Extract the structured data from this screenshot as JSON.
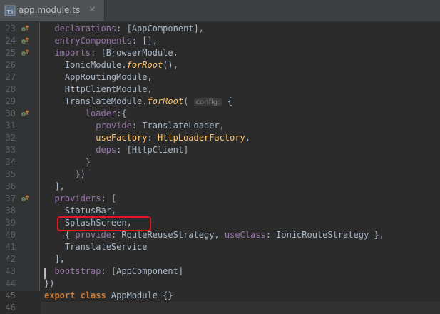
{
  "tab": {
    "icon_label": "TS",
    "title": "app.module.ts",
    "close_glyph": "×"
  },
  "colors": {
    "keyword": "#cc7832",
    "property": "#9876aa",
    "function": "#ffc66d",
    "default_text": "#a9b7c6",
    "highlight_box": "#e0191d"
  },
  "editor": {
    "line_numbers": [
      "23",
      "24",
      "25",
      "26",
      "27",
      "28",
      "29",
      "30",
      "31",
      "32",
      "33",
      "34",
      "35",
      "36",
      "37",
      "38",
      "39",
      "40",
      "41",
      "42",
      "43",
      "44",
      "45",
      "46"
    ],
    "lines": [
      {
        "indent": "  ",
        "t": [
          [
            "p",
            "declarations"
          ],
          [
            "d",
            ": [AppComponent],"
          ]
        ]
      },
      {
        "indent": "  ",
        "t": [
          [
            "p",
            "entryComponents"
          ],
          [
            "d",
            ": [],"
          ]
        ]
      },
      {
        "indent": "  ",
        "t": [
          [
            "p",
            "imports"
          ],
          [
            "d",
            ": [BrowserModule,"
          ]
        ]
      },
      {
        "indent": "    ",
        "t": [
          [
            "d",
            "IonicModule."
          ],
          [
            "f",
            "forRoot"
          ],
          [
            "d",
            "(),"
          ]
        ]
      },
      {
        "indent": "    ",
        "t": [
          [
            "d",
            "AppRoutingModule,"
          ]
        ]
      },
      {
        "indent": "    ",
        "t": [
          [
            "d",
            "HttpClientModule,"
          ]
        ]
      },
      {
        "indent": "    ",
        "t": [
          [
            "d",
            "TranslateModule."
          ],
          [
            "f",
            "forRoot"
          ],
          [
            "d",
            "( "
          ],
          [
            "h",
            "config:"
          ],
          [
            "d",
            " {"
          ]
        ]
      },
      {
        "indent": "        ",
        "t": [
          [
            "p",
            "loader"
          ],
          [
            "d",
            ":{"
          ]
        ]
      },
      {
        "indent": "          ",
        "t": [
          [
            "p",
            "provide"
          ],
          [
            "d",
            ": TranslateLoader,"
          ]
        ]
      },
      {
        "indent": "          ",
        "t": [
          [
            "y",
            "useFactory"
          ],
          [
            "d",
            ": "
          ],
          [
            "y",
            "HttpLoaderFactory"
          ],
          [
            "d",
            ","
          ]
        ]
      },
      {
        "indent": "          ",
        "t": [
          [
            "p",
            "deps"
          ],
          [
            "d",
            ": [HttpClient]"
          ]
        ]
      },
      {
        "indent": "        ",
        "t": [
          [
            "d",
            "}"
          ]
        ]
      },
      {
        "indent": "      ",
        "t": [
          [
            "d",
            "})"
          ]
        ]
      },
      {
        "indent": "  ",
        "t": [
          [
            "d",
            "],"
          ]
        ]
      },
      {
        "indent": "  ",
        "t": [
          [
            "p",
            "providers"
          ],
          [
            "d",
            ": ["
          ]
        ]
      },
      {
        "indent": "    ",
        "t": [
          [
            "d",
            "StatusBar,"
          ]
        ]
      },
      {
        "indent": "    ",
        "t": [
          [
            "d",
            "SplashScreen,"
          ]
        ]
      },
      {
        "indent": "    ",
        "t": [
          [
            "d",
            "{ "
          ],
          [
            "p",
            "provide"
          ],
          [
            "d",
            ": RouteReuseStrategy, "
          ],
          [
            "p",
            "useClass"
          ],
          [
            "d",
            ": IonicRouteStrategy },"
          ]
        ]
      },
      {
        "indent": "    ",
        "t": [
          [
            "d",
            "TranslateService"
          ]
        ]
      },
      {
        "indent": "  ",
        "t": [
          [
            "d",
            "],"
          ]
        ]
      },
      {
        "indent": "  ",
        "t": [
          [
            "p",
            "bootstrap"
          ],
          [
            "d",
            ": [AppComponent]"
          ]
        ]
      },
      {
        "indent": "",
        "t": [
          [
            "d",
            "})"
          ]
        ]
      },
      {
        "indent": "",
        "t": [
          [
            "k",
            "export class"
          ],
          [
            "d",
            " AppModule {}"
          ]
        ]
      },
      {
        "indent": "",
        "t": [
          [
            "d",
            ""
          ]
        ]
      }
    ],
    "markers_on_lines": [
      "23",
      "24",
      "25",
      "30",
      "37"
    ],
    "highlighted_line": "41"
  }
}
